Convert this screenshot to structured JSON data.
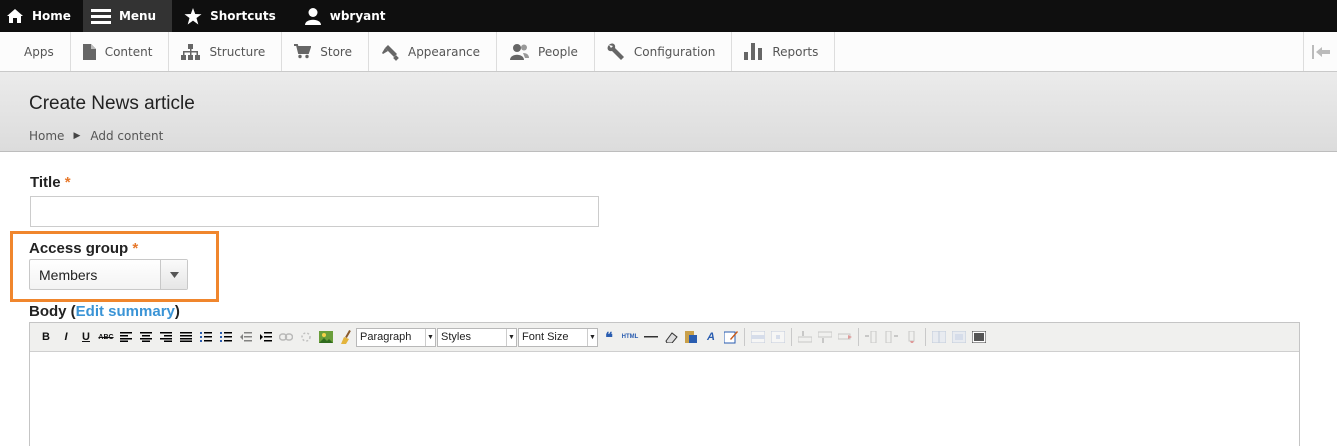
{
  "topbar": {
    "items": [
      {
        "label": "Home",
        "icon": "home-icon"
      },
      {
        "label": "Menu",
        "icon": "menu-icon",
        "active": true
      },
      {
        "label": "Shortcuts",
        "icon": "star-icon"
      },
      {
        "label": "wbryant",
        "icon": "user-icon"
      }
    ]
  },
  "tray": {
    "items": [
      {
        "label": "Apps"
      },
      {
        "label": "Content",
        "icon": "content-icon"
      },
      {
        "label": "Structure",
        "icon": "structure-icon"
      },
      {
        "label": "Store",
        "icon": "cart-icon"
      },
      {
        "label": "Appearance",
        "icon": "brush-icon"
      },
      {
        "label": "People",
        "icon": "people-icon"
      },
      {
        "label": "Configuration",
        "icon": "wrench-icon"
      },
      {
        "label": "Reports",
        "icon": "bar-chart-icon"
      }
    ]
  },
  "header": {
    "title": "Create News article",
    "breadcrumb": [
      "Home",
      "Add content"
    ]
  },
  "form": {
    "title_label": "Title",
    "required_mark": "*",
    "title_value": "",
    "access_group_label": "Access group",
    "access_group_value": "Members",
    "body_label": "Body",
    "body_open_paren": "(",
    "edit_summary_link": "Edit summary",
    "body_close_paren": ")"
  },
  "editor": {
    "format_select": "Paragraph",
    "styles_select": "Styles",
    "fontsize_select": "Font Size",
    "bold": "B",
    "italic": "I",
    "underline": "U",
    "strike": "ABC",
    "html": "HTML"
  },
  "colors": {
    "accent": "#f0862d",
    "required": "#e7792c",
    "link": "#3a94d6"
  }
}
